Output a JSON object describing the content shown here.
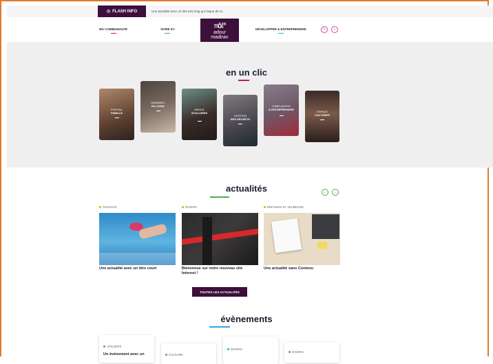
{
  "flash": {
    "label": "FLASH INFO",
    "icon": "clock-icon",
    "text": "Une actualité avec un titre très long qui risque de re..."
  },
  "nav": {
    "items": [
      {
        "label": "MA COMMUNAUTÉ",
        "accent": "#c2185b"
      },
      {
        "label": "VIVRE ICI",
        "accent": "#4caf50"
      },
      {
        "label": "DÉVELOPPER & ENTREPRENDRE",
        "accent": "#29a8e0"
      }
    ],
    "logo": {
      "glyph": "≡ô⁞°",
      "line1": "adour",
      "line2": "madiran"
    },
    "icons": [
      "accessibility-icon",
      "search-icon"
    ]
  },
  "clic": {
    "title": "en un clic",
    "cards": [
      {
        "line1": "PORTAIL",
        "line2": "FAMILLE"
      },
      {
        "line1": "PAIEMENT",
        "line2": "EN LIGNE"
      },
      {
        "line1": "MENUS",
        "line2": "SCOLAIRES"
      },
      {
        "line1": "GESTION",
        "line2": "DES DÉCHETS"
      },
      {
        "line1": "S'IMPLANTER",
        "line2": "& ENTREPRENDRE"
      },
      {
        "line1": "ESPACE",
        "line2": "CULTURES"
      }
    ]
  },
  "news": {
    "title": "actualités",
    "items": [
      {
        "category": "TRAVAUX",
        "dot": "#b5c400",
        "title": "Une actualité avec un titre court"
      },
      {
        "category": "DIVERS",
        "dot": "#b5c400",
        "title": "Bienvenue sur notre nouveau site Internet !"
      },
      {
        "category": "ENFANCE ET JEUNESSE",
        "dot": "#b5c400",
        "title": "Une actualité sans Contenu"
      }
    ],
    "all_button": "TOUTES LES ACTUALITÉS"
  },
  "events": {
    "title": "évènements",
    "items": [
      {
        "category": "ATELIERS",
        "title": "Un évènement avec un"
      },
      {
        "category": "CULTURE",
        "title": ""
      },
      {
        "category": "DIVERS",
        "title": ""
      },
      {
        "category": "DIVERS",
        "title": ""
      }
    ]
  },
  "colors": {
    "brand": "#3d0f3b",
    "accent_pink": "#c2185b",
    "accent_green": "#4caf50",
    "accent_blue": "#29a8e0",
    "frame": "#e07a2a"
  }
}
